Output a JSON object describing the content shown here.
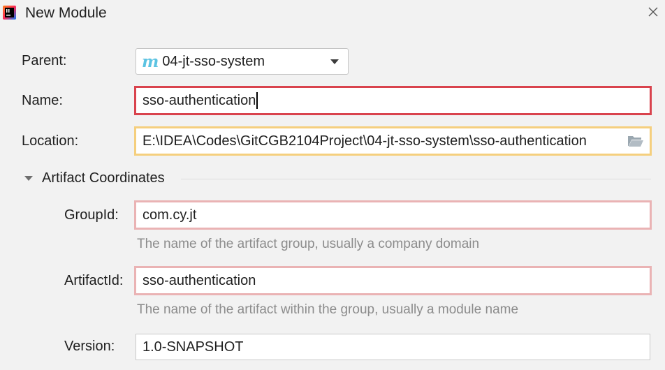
{
  "window": {
    "title": "New Module"
  },
  "form": {
    "parent": {
      "label": "Parent:",
      "value": "04-jt-sso-system"
    },
    "name": {
      "label": "Name:",
      "value": "sso-authentication"
    },
    "location": {
      "label": "Location:",
      "value": "E:\\IDEA\\Codes\\GitCGB2104Project\\04-jt-sso-system\\sso-authentication"
    }
  },
  "artifact": {
    "section_label": "Artifact Coordinates",
    "group_id": {
      "label": "GroupId:",
      "value": "com.cy.jt",
      "hint": "The name of the artifact group, usually a company domain"
    },
    "artifact_id": {
      "label": "ArtifactId:",
      "value": "sso-authentication",
      "hint": "The name of the artifact within the group, usually a module name"
    },
    "version": {
      "label": "Version:",
      "value": "1.0-SNAPSHOT"
    }
  },
  "colors": {
    "error_border": "#d9434d",
    "warning_border": "#f5cf7e",
    "soft_error_border": "#eab3b4",
    "maven_icon": "#5cc3e2"
  },
  "icons": [
    "intellij-icon",
    "close-icon",
    "maven-module-icon",
    "chevron-down-icon",
    "folder-icon",
    "triangle-down-icon"
  ]
}
